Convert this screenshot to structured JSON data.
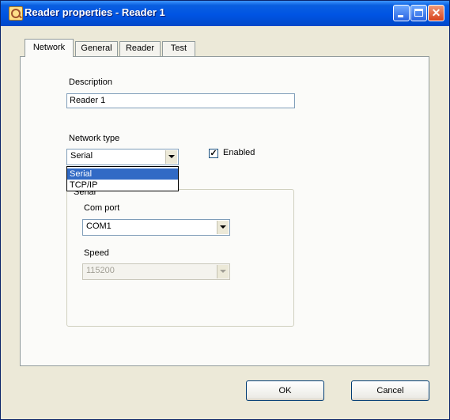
{
  "window": {
    "title": "Reader properties - Reader 1"
  },
  "titlebar_icons": [
    "reader-app-icon",
    "minimize-icon",
    "maximize-icon",
    "close-icon"
  ],
  "tabs": [
    {
      "label": "Network",
      "active": true
    },
    {
      "label": "General",
      "active": false
    },
    {
      "label": "Reader",
      "active": false
    },
    {
      "label": "Test",
      "active": false
    }
  ],
  "network": {
    "description_label": "Description",
    "description_value": "Reader 1",
    "network_type_label": "Network type",
    "network_type_value": "Serial",
    "network_type_options": [
      "Serial",
      "TCP/IP"
    ],
    "network_type_highlighted": "Serial",
    "enabled_label": "Enabled",
    "enabled_checked": true,
    "enabled_mark": "✓",
    "serial_group_label": "Serial",
    "com_port_label": "Com port",
    "com_port_value": "COM1",
    "speed_label": "Speed",
    "speed_value": "115200",
    "speed_disabled": true
  },
  "buttons": {
    "ok": "OK",
    "cancel": "Cancel"
  },
  "colors": {
    "titlebar": "#0054e3",
    "selection": "#316ac5",
    "dialog_bg": "#ece9d8"
  }
}
